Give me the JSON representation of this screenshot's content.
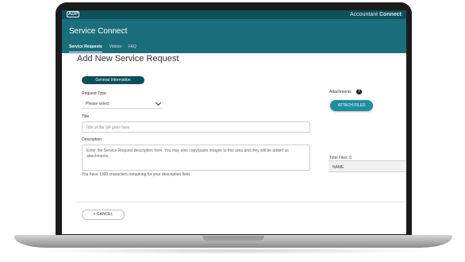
{
  "topbar": {
    "brand_prefix": "Accountant",
    "brand_suffix": "Connect",
    "logo_text": "ADP"
  },
  "header": {
    "title": "Service Connect"
  },
  "nav": {
    "tabs": [
      {
        "label": "Service Requests",
        "active": true
      },
      {
        "label": "Videos"
      },
      {
        "label": "FAQ"
      }
    ]
  },
  "page": {
    "title": "Add New Service Request"
  },
  "section_pill": "General Information",
  "form": {
    "request_type_label": "Request Type",
    "request_type_value": "Please select",
    "title_label": "Title",
    "title_placeholder": "Title of the SR goes here",
    "description_label": "Description",
    "description_text": "Enter the Service Request description here. You may also copy/paste images to this area and they will be added as attachments.",
    "helper": "You have 1300 characters remaining for your description field."
  },
  "attachments": {
    "title": "Attachments",
    "help_icon": "question-circle-icon",
    "button": "ATTACH FILES",
    "total": "Total Files: 0",
    "column": "NAME"
  },
  "footer": {
    "cancel": "< CANCEL"
  },
  "colors": {
    "header": "#1a6e7c",
    "topbar": "#0e4f5c",
    "accent": "#1f8ea1"
  }
}
